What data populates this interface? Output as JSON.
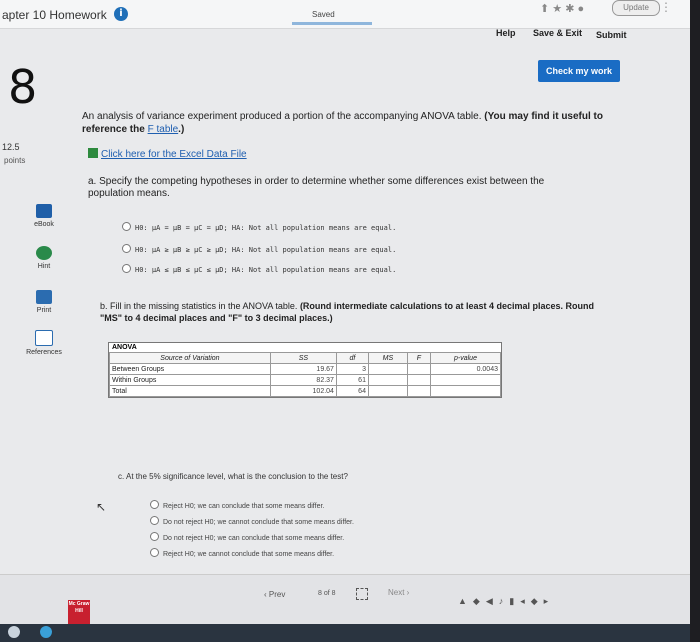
{
  "header": {
    "chapter_title": "apter 10 Homework",
    "info_icon": "i",
    "saved": "Saved",
    "update": "Update",
    "help": "Help",
    "save_exit": "Save & Exit",
    "submit": "Submit",
    "check_work": "Check my work"
  },
  "question": {
    "number": "8",
    "points_value": "12.5",
    "points_label": "points"
  },
  "sidebar": {
    "items": [
      {
        "label": "eBook"
      },
      {
        "label": "Hint"
      },
      {
        "label": "Print"
      },
      {
        "label": "References"
      }
    ]
  },
  "content": {
    "intro": "An analysis of variance experiment produced a portion of the accompanying ANOVA table.",
    "intro_bold": "(You may find it useful to reference the",
    "ftable_link": "F table",
    "intro_tail": ".)",
    "excel_link": "Click here for the Excel Data File",
    "part_a": "a. Specify the competing hypotheses in order to determine whether some differences exist between the population means.",
    "hypothesis_options": [
      "H0: μA = μB = μC = μD; HA: Not all population means are equal.",
      "H0: μA ≥ μB ≥ μC ≥ μD; HA: Not all population means are equal.",
      "H0: μA ≤ μB ≤ μC ≤ μD; HA: Not all population means are equal."
    ],
    "part_b_lead": "b. Fill in the missing statistics in the ANOVA table.",
    "part_b_bold": "(Round intermediate calculations to at least 4 decimal places. Round \"MS\" to 4 decimal places and \"F\" to 3 decimal places.)",
    "anova": {
      "title": "ANOVA",
      "headers": [
        "Source of Variation",
        "SS",
        "df",
        "MS",
        "F",
        "p-value"
      ],
      "rows": [
        {
          "source": "Between Groups",
          "ss": "19.67",
          "df": "3",
          "p": "0.0043"
        },
        {
          "source": "Within Groups",
          "ss": "82.37",
          "df": "61"
        },
        {
          "source": "Total",
          "ss": "102.04",
          "df": "64"
        }
      ]
    },
    "part_c": "c. At the 5% significance level, what is the conclusion to the test?",
    "conclusion_options": [
      "Reject H0; we can conclude that some means differ.",
      "Do not reject H0; we cannot conclude that some means differ.",
      "Do not reject H0; we can conclude that some means differ.",
      "Reject H0; we cannot conclude that some means differ."
    ]
  },
  "footer": {
    "prev": "Prev",
    "page_current": "8",
    "page_sep": "of",
    "page_total": "8",
    "next": "Next",
    "logo": "Mc Graw Hill"
  }
}
